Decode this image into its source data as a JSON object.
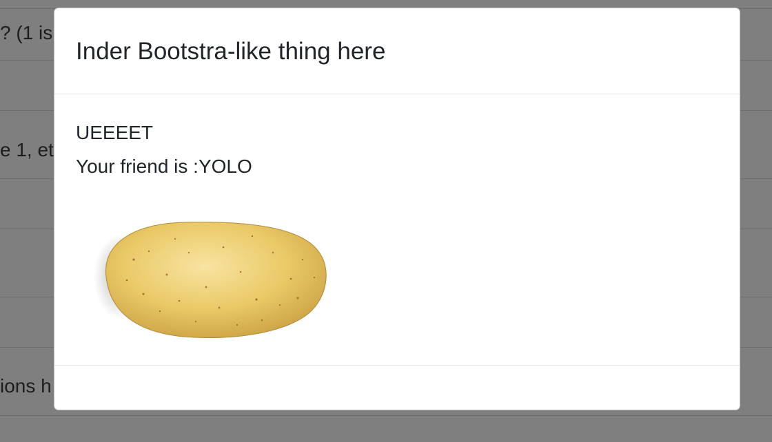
{
  "background": {
    "text_lines": [
      "? (1 is",
      "e 1, et",
      "ions h"
    ]
  },
  "modal": {
    "title": "Inder Bootstra-like thing here",
    "body": {
      "line1": "UEEEET",
      "line2": "Your friend is :YOLO",
      "image": "potato-image"
    }
  },
  "colors": {
    "backdrop": "#7f7f7f",
    "modal_bg": "#ffffff",
    "text": "#212529",
    "divider": "#dee2e6",
    "potato_skin": "#e6c263"
  }
}
